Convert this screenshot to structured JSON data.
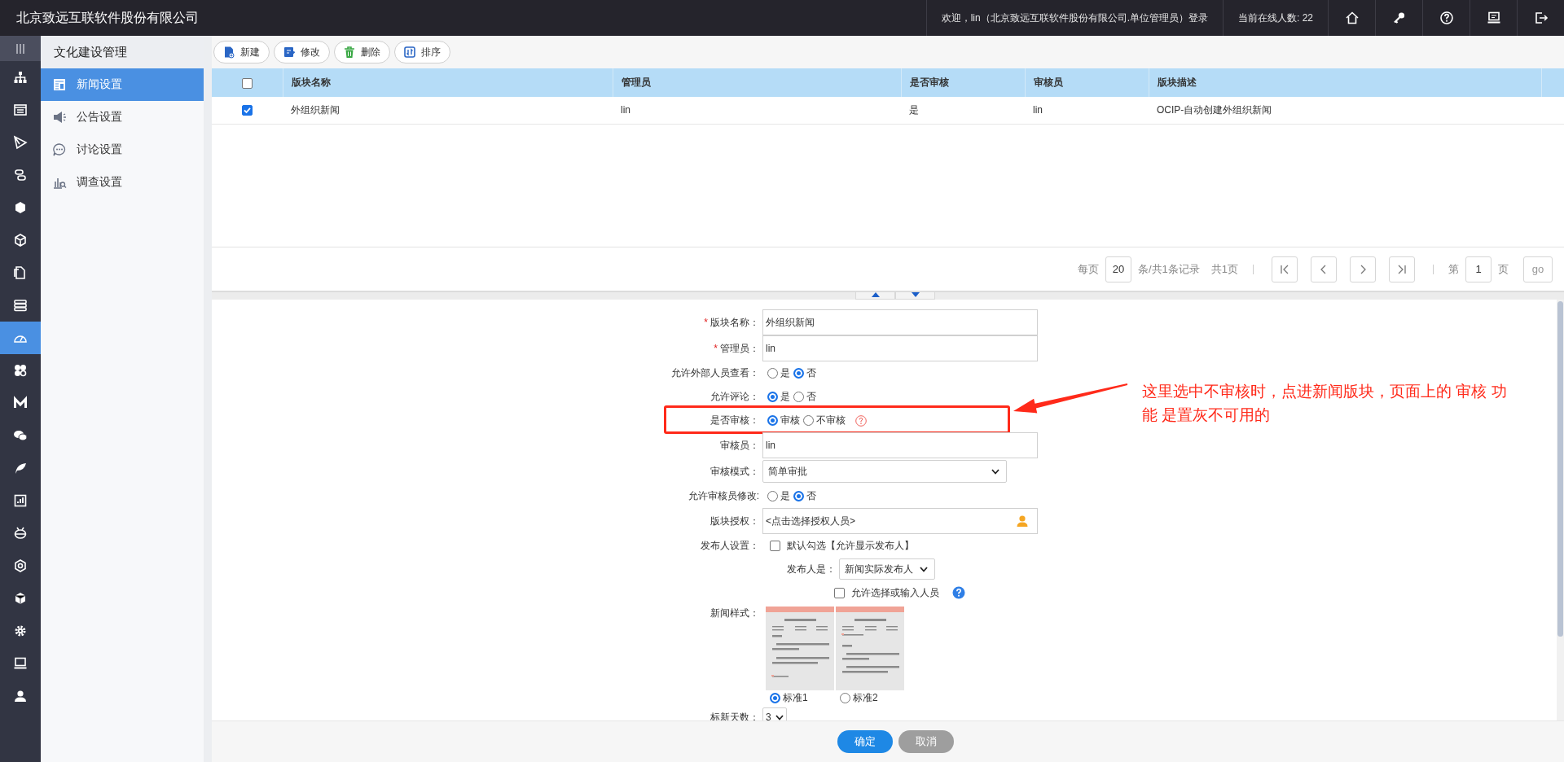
{
  "header": {
    "title": "北京致远互联软件股份有限公司",
    "welcome": "欢迎，lin（北京致远互联软件股份有限公司.单位管理员）登录",
    "online": "当前在线人数: 22"
  },
  "rail": {
    "menu_expanded": true,
    "items": [
      {
        "selected": false
      },
      {
        "selected": false
      },
      {
        "selected": false
      },
      {
        "selected": false
      },
      {
        "selected": false
      },
      {
        "selected": false
      },
      {
        "selected": false
      },
      {
        "selected": false
      },
      {
        "selected": true
      },
      {
        "selected": false
      },
      {
        "selected": false
      },
      {
        "selected": false
      },
      {
        "selected": false
      },
      {
        "selected": false
      },
      {
        "selected": false
      },
      {
        "selected": false
      },
      {
        "selected": false
      },
      {
        "selected": false
      },
      {
        "selected": false
      },
      {
        "selected": false
      }
    ]
  },
  "menu": {
    "title": "文化建设管理",
    "items": [
      {
        "label": "新闻设置",
        "selected": true
      },
      {
        "label": "公告设置",
        "selected": false
      },
      {
        "label": "讨论设置",
        "selected": false
      },
      {
        "label": "调查设置",
        "selected": false
      }
    ]
  },
  "toolbar": {
    "buttons": [
      {
        "label": "新建"
      },
      {
        "label": "修改"
      },
      {
        "label": "删除"
      },
      {
        "label": "排序"
      }
    ]
  },
  "table": {
    "header_checked": false,
    "columns": [
      "版块名称",
      "管理员",
      "是否审核",
      "审核员",
      "版块描述"
    ],
    "rows": [
      {
        "checked": true,
        "cells": [
          "外组织新闻",
          "lin",
          "是",
          "lin",
          "OCIP-自动创建外组织新闻"
        ]
      }
    ]
  },
  "pagination": {
    "per_page_label": "每页",
    "per_page": "20",
    "summary": "条/共1条记录",
    "pages": "共1页",
    "page_prefix": "第",
    "page": "1",
    "page_suffix": "页",
    "go": "go"
  },
  "form": {
    "fields": [
      {
        "kind": "text",
        "required_mark": "*",
        "label": "版块名称：",
        "value": "外组织新闻",
        "highlighted": false
      },
      {
        "kind": "text",
        "required_mark": "*",
        "label": "管理员：",
        "value": "lin",
        "highlighted": false
      },
      {
        "kind": "radio",
        "label": "允许外部人员查看：",
        "options": [
          {
            "label": "是",
            "selected": false
          },
          {
            "label": "否",
            "selected": true
          }
        ],
        "highlighted": false
      },
      {
        "kind": "radio",
        "label": "允许评论：",
        "options": [
          {
            "label": "是",
            "selected": true
          },
          {
            "label": "否",
            "selected": false
          }
        ],
        "highlighted": false
      },
      {
        "kind": "radio",
        "label": "是否审核：",
        "options": [
          {
            "label": "审核",
            "selected": true
          },
          {
            "label": "不审核",
            "selected": false
          }
        ],
        "help": true,
        "highlighted": true
      },
      {
        "kind": "text",
        "label": "审核员：",
        "value": "lin",
        "highlighted": false
      },
      {
        "kind": "select",
        "label": "审核模式：",
        "value": "简单审批",
        "highlighted": false
      },
      {
        "kind": "radio",
        "label": "允许审核员修改:",
        "options": [
          {
            "label": "是",
            "selected": false
          },
          {
            "label": "否",
            "selected": true
          }
        ],
        "highlighted": false
      },
      {
        "kind": "picker",
        "label": "版块授权：",
        "value": "<点击选择授权人员>",
        "highlighted": false
      },
      {
        "kind": "checkbox",
        "label": "发布人设置：",
        "text": "默认勾选【允许显示发布人】",
        "checked": false,
        "highlighted": false
      },
      {
        "kind": "sub-select",
        "label": "发布人是：",
        "value": "新闻实际发布人",
        "highlighted": false
      },
      {
        "kind": "sub-checkbox",
        "text": "允许选择或输入人员",
        "checked": false,
        "help": true,
        "highlighted": false
      },
      {
        "kind": "styles",
        "label": "新闻样式：",
        "options": [
          {
            "label": "标准1",
            "selected": true
          },
          {
            "label": "标准2",
            "selected": false
          }
        ],
        "highlighted": false
      },
      {
        "kind": "short-select",
        "label": "标新天数：",
        "value": "3",
        "highlighted": false
      }
    ]
  },
  "footer": {
    "buttons": [
      {
        "label": "确定",
        "kind": "primary"
      },
      {
        "label": "取消",
        "kind": "secondary"
      }
    ]
  },
  "annotation": {
    "text": "这里选中不审核时，点进新闻版块，页面上的 审核 功能 是置灰不可用的"
  }
}
